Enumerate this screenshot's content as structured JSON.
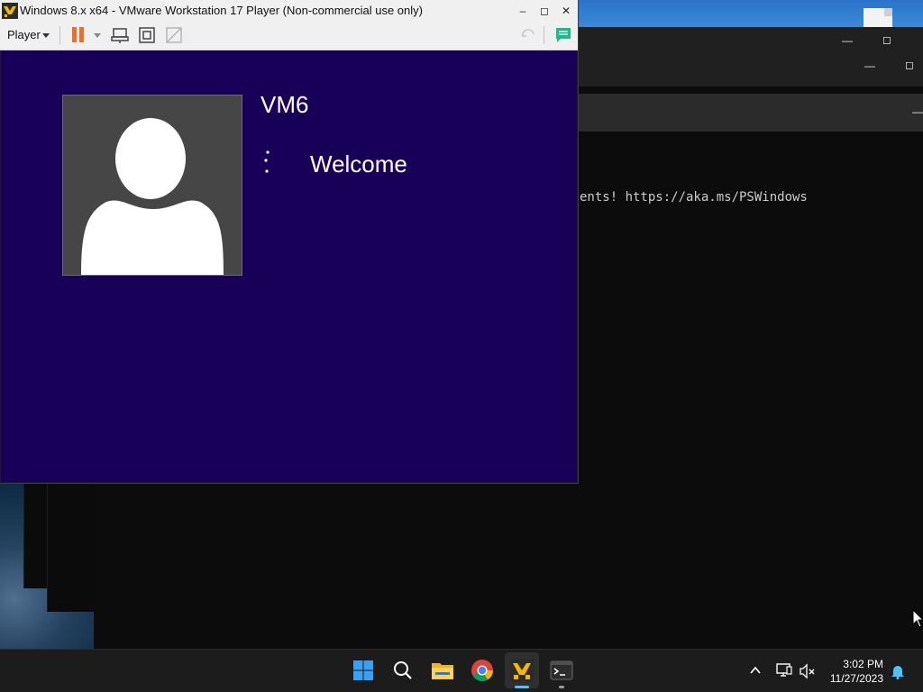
{
  "vmware": {
    "title": "Windows 8.x x64 - VMware Workstation 17 Player (Non-commercial use only)",
    "player_menu": "Player",
    "minimize": "–",
    "maximize": "◻",
    "close": "✕"
  },
  "guest": {
    "vm_name": "VM6",
    "status": "Welcome",
    "background_color": "#180059"
  },
  "terminal": {
    "visible_line": "ents! https://aka.ms/PSWindows"
  },
  "taskbar": {
    "time": "3:02 PM",
    "date": "11/27/2023",
    "apps": [
      "start-icon",
      "search-icon",
      "file-explorer-icon",
      "chrome-icon",
      "vmware-player-icon",
      "terminal-icon"
    ],
    "tray": [
      "chevron-up-icon",
      "network-icon",
      "volume-muted-icon",
      "notification-bell-icon"
    ],
    "accent": "#4cc2ff"
  }
}
